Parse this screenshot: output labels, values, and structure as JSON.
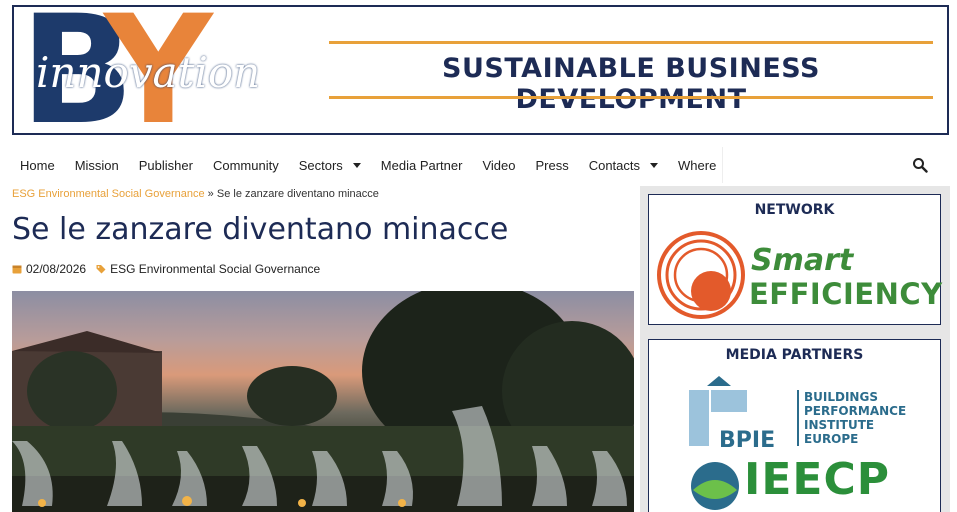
{
  "header": {
    "logo_innovation": "innovation",
    "logo_letters": [
      "B",
      "Y"
    ],
    "tagline": "SUSTAINABLE BUSINESS DEVELOPMENT"
  },
  "nav": {
    "items": [
      {
        "label": "Home"
      },
      {
        "label": "Mission"
      },
      {
        "label": "Publisher"
      },
      {
        "label": "Community"
      },
      {
        "label": "Sectors",
        "dropdown": true
      },
      {
        "label": "Media Partner"
      },
      {
        "label": "Video"
      },
      {
        "label": "Press"
      },
      {
        "label": "Contacts",
        "dropdown": true
      },
      {
        "label": "Where"
      }
    ],
    "search_icon": "search-icon"
  },
  "breadcrumb": {
    "parent": "ESG Environmental Social Governance",
    "separator": "»",
    "current": "Se le zanzare diventano minacce"
  },
  "article": {
    "title": "Se le zanzare diventano minacce",
    "date": "02/08/2026",
    "category": "ESG Environmental Social Governance"
  },
  "sidebar": {
    "network_title": "NETWORK",
    "smart_efficiency": {
      "line1": "Smart",
      "line2": "EFFICIENCY"
    },
    "media_partners_title": "MEDIA PARTNERS",
    "bpie": {
      "word": "BPIE",
      "lines": [
        "BUILDINGS",
        "PERFORMANCE",
        "INSTITUTE",
        "EUROPE"
      ]
    },
    "ieecp": {
      "word": "IEECP"
    }
  },
  "colors": {
    "navy": "#1d2b55",
    "orange": "#e8843a",
    "gold": "#e8a13a",
    "green": "#3d8c3a",
    "teal": "#2b6c8c"
  }
}
